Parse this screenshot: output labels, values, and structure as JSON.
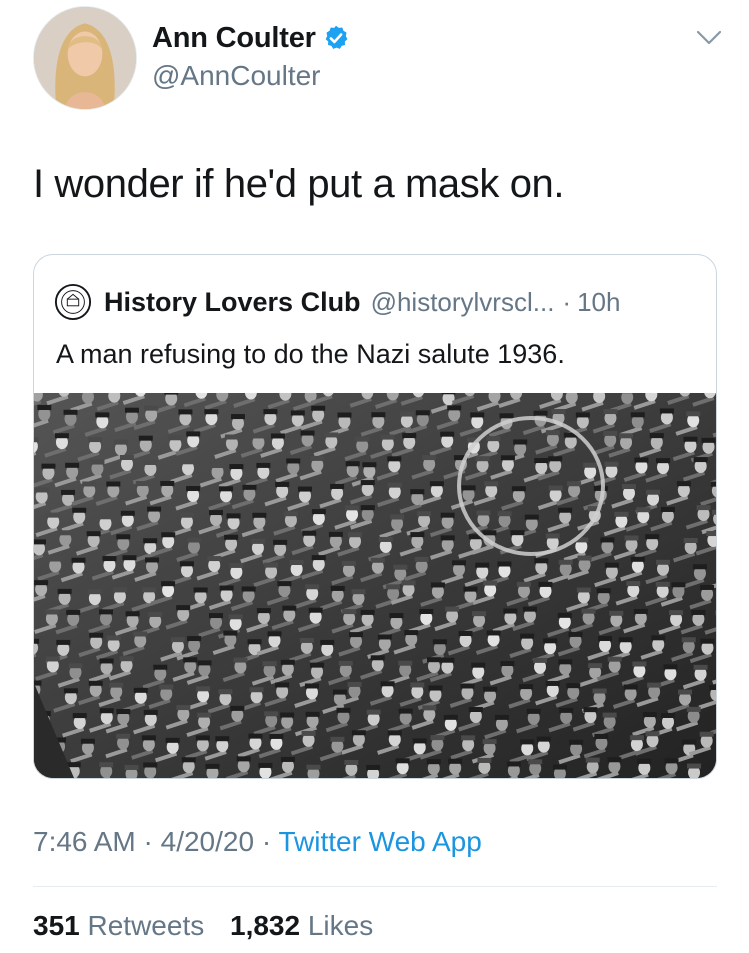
{
  "author": {
    "name": "Ann Coulter",
    "handle": "@AnnCoulter",
    "verified": true,
    "avatar_icon": "profile-photo"
  },
  "tweet": {
    "text": "I wonder if he'd put a mask on."
  },
  "quoted": {
    "name": "History Lovers Club",
    "handle": "@historylvrscl...",
    "separator": "·",
    "time": "10h",
    "text": "A man refusing to do the Nazi salute 1936.",
    "logo_icon": "club-seal-logo",
    "photo": "black-and-white crowd photo with circle highlight"
  },
  "meta": {
    "time": "7:46 AM",
    "date": "4/20/20",
    "sep1": "·",
    "sep2": "·",
    "source": "Twitter Web App"
  },
  "stats": {
    "retweets_count": "351",
    "retweets_label": "Retweets",
    "likes_count": "1,832",
    "likes_label": "Likes"
  },
  "colors": {
    "accent": "#1b95e0",
    "secondary_text": "#657786",
    "primary_text": "#14171a",
    "border": "#ccd6dd"
  }
}
